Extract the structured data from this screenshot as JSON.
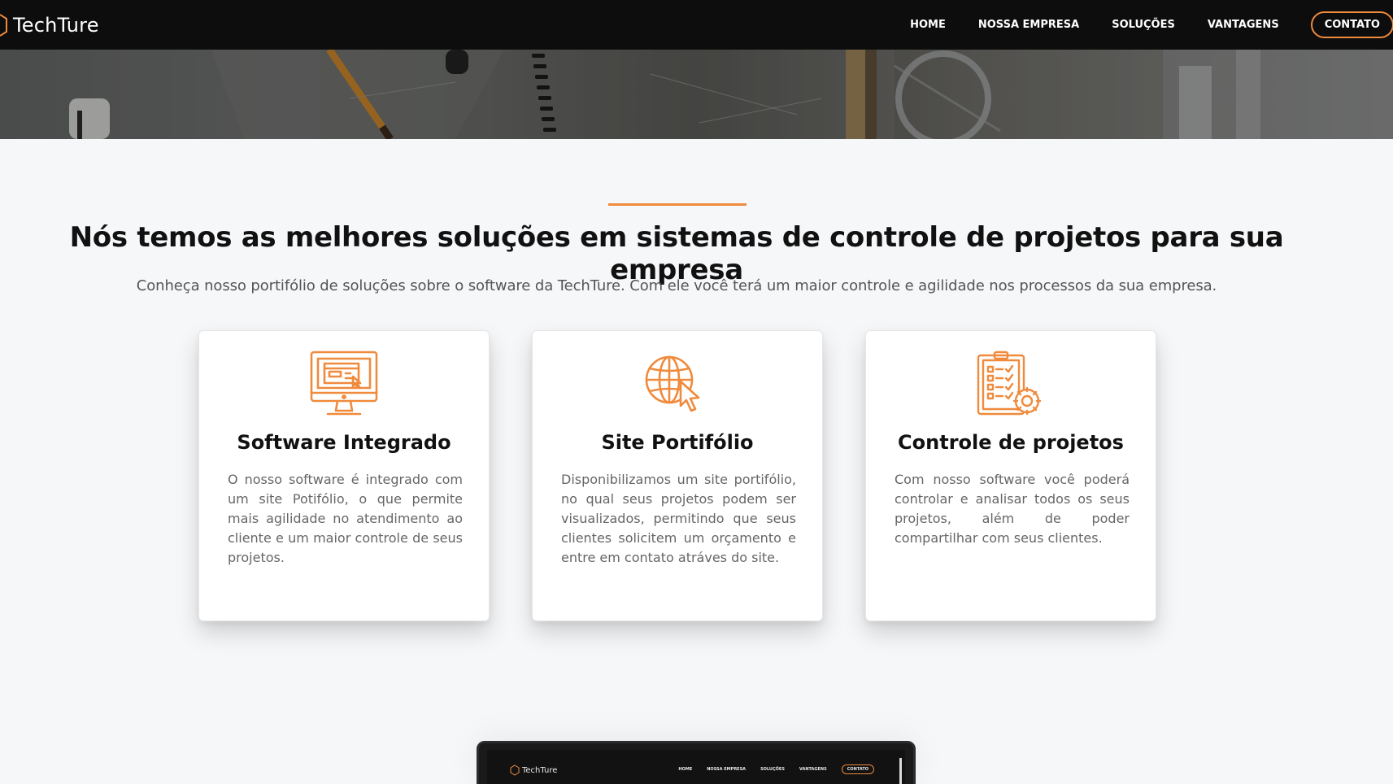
{
  "brand": {
    "name": "TechTure",
    "icon": "hexagon-logo-icon"
  },
  "nav": {
    "items": [
      "HOME",
      "NOSSA EMPRESA",
      "SOLUÇÕES",
      "VANTAGENS"
    ],
    "contact": "CONTATO"
  },
  "colors": {
    "accent": "#f08a3c",
    "navbar": "#0d0d0d",
    "background": "#f6f7f9"
  },
  "section": {
    "heading": "Nós temos as melhores soluções em sistemas de controle de projetos para sua empresa",
    "subheading": "Conheça nosso portifólio de soluções sobre o software da TechTure. Com ele você terá um maior controle e agilidade nos processos da sua empresa."
  },
  "cards": [
    {
      "icon": "monitor-icon",
      "title": "Software Integrado",
      "text": "O nosso software é integrado com um site Potifólio, o que permite mais agilidade no atendimento ao cliente e um maior controle de seus projetos."
    },
    {
      "icon": "globe-cursor-icon",
      "title": "Site Portifólio",
      "text": "Disponibilizamos um site portifólio, no qual seus projetos podem ser visualizados, permitindo que seus clientes solicitem um orçamento e entre em contato atráves do site."
    },
    {
      "icon": "clipboard-gear-icon",
      "title": "Controle de projetos",
      "text": "Com nosso software você poderá controlar e analisar todos os seus projetos, além de poder compartilhar com seus clientes."
    }
  ],
  "preview": {
    "brand": "TechTure",
    "nav": [
      "HOME",
      "NOSSA EMPRESA",
      "SOLUÇÕES",
      "VANTAGENS"
    ],
    "contact": "CONTATO"
  }
}
